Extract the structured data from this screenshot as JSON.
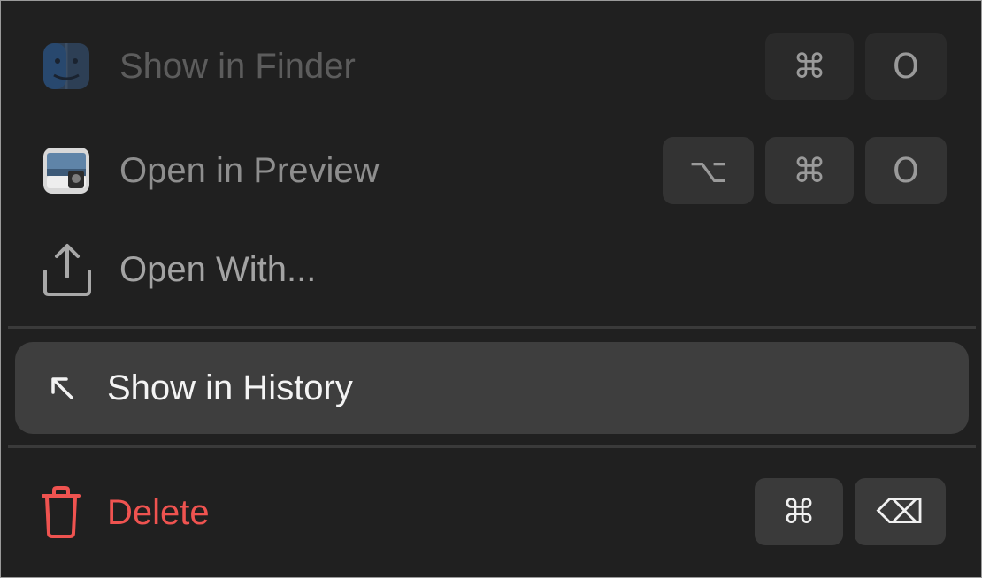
{
  "menu": {
    "items": [
      {
        "label": "Show in Finder",
        "icon": "finder-icon",
        "shortcut": [
          "⌘",
          "O"
        ]
      },
      {
        "label": "Open in Preview",
        "icon": "preview-icon",
        "shortcut": [
          "⌥",
          "⌘",
          "O"
        ]
      },
      {
        "label": "Open With...",
        "icon": "share-icon"
      },
      {
        "label": "Show in History",
        "icon": "arrow-up-left-icon"
      },
      {
        "label": "Delete",
        "icon": "trash-icon",
        "shortcut": [
          "⌘",
          "⌫"
        ]
      }
    ]
  },
  "colors": {
    "background": "#202020",
    "highlight": "#3e3e3e",
    "destructive": "#ef5350",
    "keycap": "#333333"
  }
}
